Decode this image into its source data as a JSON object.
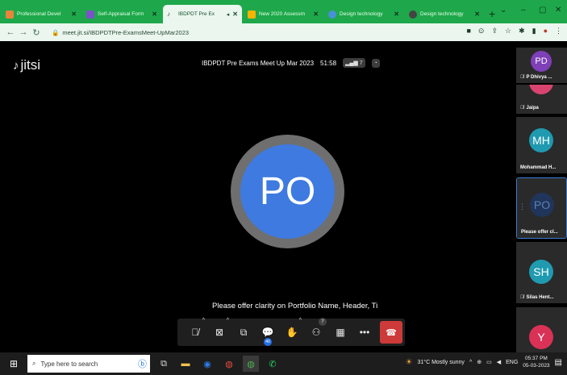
{
  "browser": {
    "tabs": [
      {
        "title": "Professional Devel",
        "color": "#e8843c",
        "active": false
      },
      {
        "title": "Self-Appraisal Form",
        "color": "#7b53c8",
        "active": false
      },
      {
        "title": "IBDPDT Pre Ex",
        "color": "#1c5130",
        "active": true
      },
      {
        "title": "New 2020 Assessm",
        "color": "#f4b400",
        "active": false
      },
      {
        "title": "Design technology",
        "color": "#4a90d9",
        "active": false
      },
      {
        "title": "Design technology",
        "color": "#444444",
        "active": false
      }
    ],
    "new_tab": "+",
    "url": "meet.jit.si/IBDPDTPre-ExamsMeet-UpMar2023"
  },
  "meeting": {
    "logo": "jitsi",
    "title": "IBDPDT Pre Exams Meet Up Mar 2023",
    "timer": "51:58",
    "participant_count": "7",
    "active_speaker_initials": "PO",
    "subtitle": "Please offer clarity on Portfolio Name, Header, Ti",
    "chat_badge": "40",
    "participants_badge": "7",
    "colors": {
      "avatar_blue": "#3e7ae0",
      "hangup_red": "#cc3a3a"
    }
  },
  "filmstrip": [
    {
      "initials": "PD",
      "name": "P Dhivya ...",
      "color": "#7e3fb7",
      "muted": true
    },
    {
      "initials": "",
      "name": "Jaipa",
      "color": "#d94370",
      "muted": true
    },
    {
      "initials": "MH",
      "name": "Mohammad H...",
      "color": "#1f9ab0",
      "muted": false
    },
    {
      "initials": "PO",
      "name": "Please offer cl...",
      "color": "#20355a",
      "muted": false
    },
    {
      "initials": "SH",
      "name": "Silas Hent...",
      "color": "#1f9ab0",
      "muted": true
    },
    {
      "initials": "Y",
      "name": "",
      "color": "#d93256",
      "muted": false
    }
  ],
  "taskbar": {
    "search_placeholder": "Type here to search",
    "weather": "31°C  Mostly sunny",
    "lang": "ENG",
    "time": "05:37 PM",
    "date": "05-03-2023"
  }
}
